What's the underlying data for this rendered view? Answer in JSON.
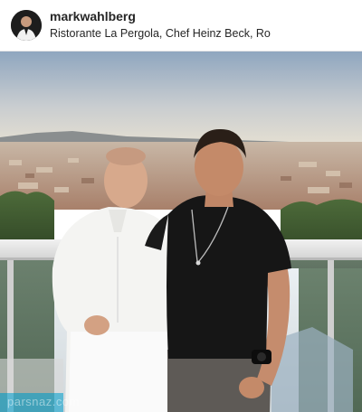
{
  "post": {
    "username": "markwahlberg",
    "location": "Ristorante La Pergola, Chef Heinz Beck, Ro"
  },
  "photo": {
    "watermark": "parsnaz.com"
  },
  "icons": {
    "avatar": "profile-avatar"
  },
  "colors": {
    "sky_top": "#93a9c0",
    "sky_bottom": "#e8e4d8",
    "city": "#b99a86",
    "chef_jacket": "#f4f4f2",
    "shirt": "#161616"
  }
}
